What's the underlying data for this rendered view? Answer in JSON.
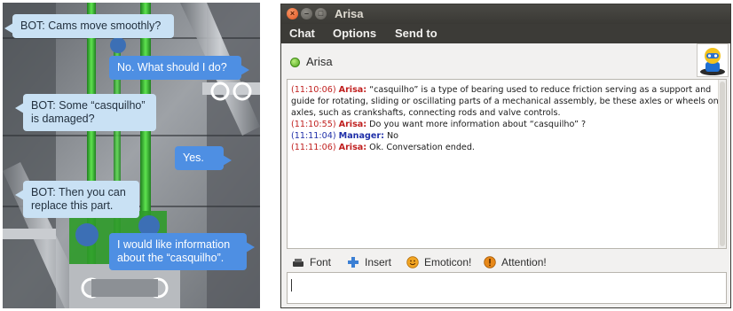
{
  "photo": {
    "bubbles": [
      {
        "role": "bot",
        "text": "BOT: Cams move smoothly?"
      },
      {
        "role": "user",
        "text": "No. What should I do?"
      },
      {
        "role": "bot",
        "text": "BOT: Some “casquilho” is damaged?"
      },
      {
        "role": "user",
        "text": "Yes."
      },
      {
        "role": "bot",
        "text": "BOT: Then you can replace this part."
      },
      {
        "role": "user",
        "text": "I would like information about the “casquilho”."
      }
    ]
  },
  "window": {
    "title": "Arisa",
    "buttons": {
      "close": "×",
      "minimize": "–",
      "maximize": "□"
    },
    "menu": {
      "chat": "Chat",
      "options": "Options",
      "send_to": "Send to"
    },
    "contact": {
      "name": "Arisa",
      "status_color": "#4fa31c",
      "avatar_icon": "robot-avatar"
    },
    "transcript": [
      {
        "time": "(11:10:06)",
        "speaker": "Arisa:",
        "text": " “casquilho” is a type of bearing used to reduce friction serving as a support and guide for rotating, sliding or oscillating parts of a mechanical assembly, be these axles or wheels on axles, such as crankshafts, connecting rods and valve controls."
      },
      {
        "time": "(11:10:55)",
        "speaker": "Arisa:",
        "text": " Do you want more information about “casquilho” ?"
      },
      {
        "time": "(11:11:04)",
        "speaker": "Manager:",
        "text": " No"
      },
      {
        "time": "(11:11:06)",
        "speaker": "Arisa:",
        "text": " Ok. Conversation ended."
      }
    ],
    "toolbar": {
      "font": {
        "label": "Font",
        "icon": "font-icon"
      },
      "insert": {
        "label": "Insert",
        "icon": "plus-icon"
      },
      "emoticon": {
        "label": "Emoticon!",
        "icon": "smiley-icon"
      },
      "attention": {
        "label": "Attention!",
        "icon": "attention-icon"
      }
    },
    "input": {
      "value": ""
    }
  },
  "colors": {
    "titlebar": "#3c3b37",
    "arisa_text": "#c0201f",
    "manager_text": "#1f2fa8",
    "bot_bubble": "#c9e1f4",
    "user_bubble": "#4e8fe3"
  }
}
